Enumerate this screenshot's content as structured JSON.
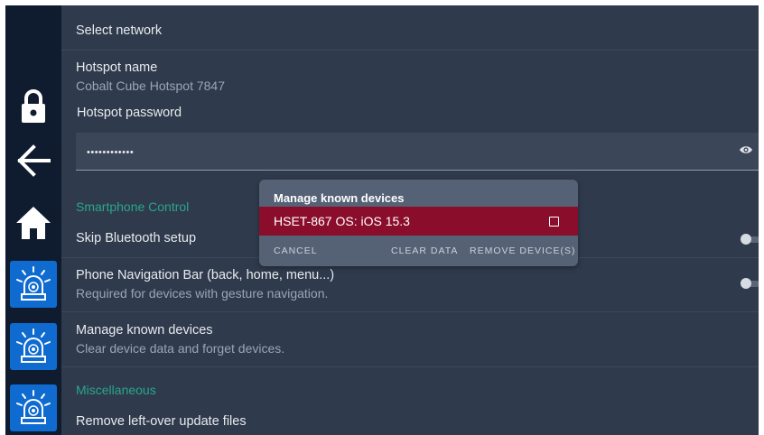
{
  "settings": {
    "select_network": "Select network",
    "hotspot_name_label": "Hotspot name",
    "hotspot_name_value": "Cobalt Cube Hotspot 7847",
    "hotspot_password_label": "Hotspot password",
    "hotspot_password_value": "••••••••••••",
    "smartphone_section": "Smartphone Control",
    "skip_bluetooth": "Skip Bluetooth setup",
    "phone_nav_bar": "Phone Navigation Bar (back, home, menu...)",
    "phone_nav_bar_sub": "Required for devices with gesture navigation.",
    "manage_devices": "Manage known devices",
    "manage_devices_sub": "Clear device data and forget devices.",
    "misc_section": "Miscellaneous",
    "remove_update_files": "Remove left-over update files"
  },
  "dialog": {
    "title": "Manage known devices",
    "device": "HSET-867 OS: iOS 15.3",
    "cancel": "CANCEL",
    "clear_data": "CLEAR DATA",
    "remove_devices": "REMOVE DEVICE(S)"
  },
  "toggles": {
    "skip_bluetooth": false,
    "phone_nav_bar": false
  },
  "colors": {
    "background": "#2f3a4c",
    "sidebar": "#0f1b2e",
    "accent_green": "#2aa68a",
    "siren_button": "#0f6bd0",
    "selected_row": "#8a0e2c",
    "dialog": "#556275"
  },
  "icons": {
    "lock": "lock-icon",
    "back": "back-arrow-icon",
    "home": "home-icon",
    "siren": "siren-icon",
    "eye": "eye-icon",
    "checkbox": "checkbox-icon"
  }
}
